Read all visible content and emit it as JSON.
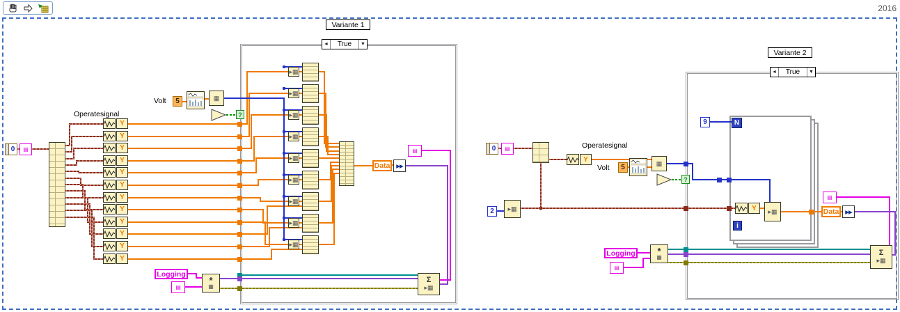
{
  "window": {
    "year": "2016"
  },
  "toolbar": {
    "tools": [
      "scroll-hand",
      "navigate-arrow",
      "step-debug"
    ]
  },
  "glyphs": {
    "case_prev": "◄",
    "case_menu": "▼",
    "bool_query": "?",
    "ddt_arrows": "▶▶",
    "sum": "Σ",
    "grid": "▦",
    "arrow_grid": "▸▦",
    "star": "*",
    "pink_glyph": "▤"
  },
  "v1": {
    "title": "Variante 1",
    "case_value": "True",
    "operate_label": "Operatesignal",
    "volt_label": "Volt",
    "volt_value": "5",
    "init_value": "0",
    "y_label": "Y",
    "data_label": "Data",
    "logging_label": "Logging"
  },
  "v2": {
    "title": "Variante 2",
    "case_value": "True",
    "operate_label": "Operatesignal",
    "volt_label": "Volt",
    "volt_value": "5",
    "init_value": "0",
    "index_value": "2",
    "count_value": "9",
    "n_label": "N",
    "i_label": "i",
    "y_label": "Y",
    "data_label": "Data",
    "logging_label": "Logging"
  },
  "colors": {
    "wire-dbl": "#F07A00",
    "wire-int": "#2433C8",
    "wire-cluster": "#8A2B1C",
    "wire-cluster-h": "#EFB09B",
    "wire-err": "#7F7A00",
    "wire-err-h": "#E8E050",
    "wire-teal": "#008F8F",
    "wire-violet": "#8844CC",
    "wire-magenta": "#E400E4",
    "wire-bool": "#009900",
    "node-bg": "#FBF3C4",
    "node-border": "#3A3A28",
    "case-border": "#9A9A9E",
    "select-dash": "#3E6EC0",
    "term-blue": "#2D43C0",
    "year-fg": "#555555"
  }
}
